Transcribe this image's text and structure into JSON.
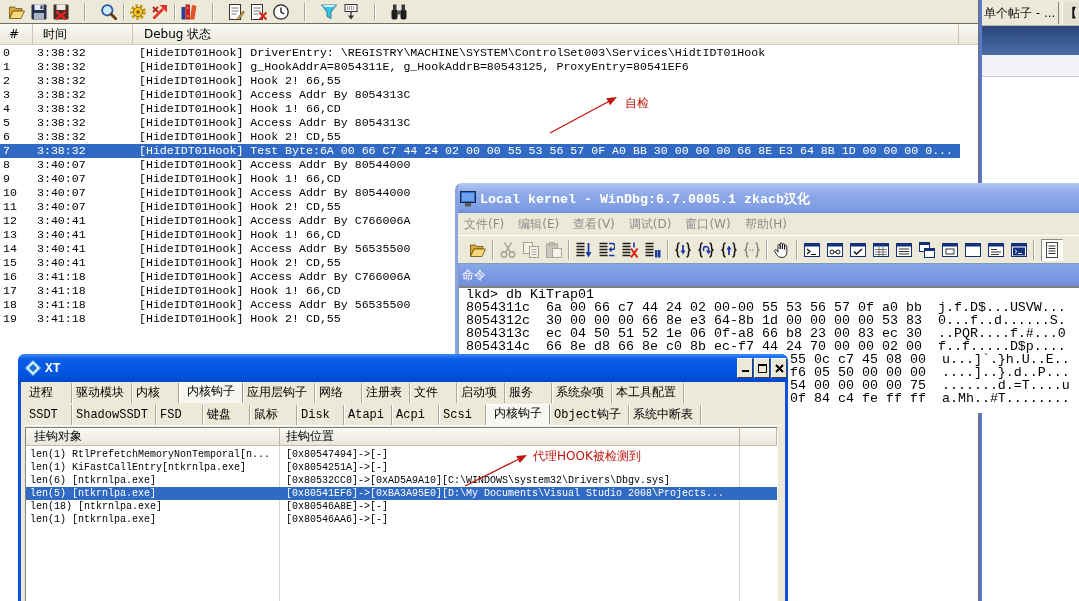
{
  "log_viewer": {
    "columns": [
      "#",
      "时间",
      "Debug 状态"
    ],
    "rows": [
      {
        "index": "0",
        "time": "3:38:32",
        "message": "[HideIDT01Hook] DriverEntry: \\REGISTRY\\MACHINE\\SYSTEM\\ControlSet003\\Services\\HidtIDT01Hook",
        "selected": false
      },
      {
        "index": "1",
        "time": "3:38:32",
        "message": "[HideIDT01Hook] g_HookAddrA=8054311E, g_HookAddrB=80543125, ProxyEntry=80541EF6",
        "selected": false
      },
      {
        "index": "2",
        "time": "3:38:32",
        "message": "[HideIDT01Hook] Hook 2! 66,55",
        "selected": false
      },
      {
        "index": "3",
        "time": "3:38:32",
        "message": "[HideIDT01Hook] Access Addr By 8054313C",
        "selected": false
      },
      {
        "index": "4",
        "time": "3:38:32",
        "message": "[HideIDT01Hook] Hook 1! 66,CD",
        "selected": false
      },
      {
        "index": "5",
        "time": "3:38:32",
        "message": "[HideIDT01Hook] Access Addr By 8054313C",
        "selected": false
      },
      {
        "index": "6",
        "time": "3:38:32",
        "message": "[HideIDT01Hook] Hook 2! CD,55",
        "selected": false
      },
      {
        "index": "7",
        "time": "3:38:32",
        "message": "[HideIDT01Hook] Test Byte:6A 00 66 C7 44 24 02 00 00 55 53 56 57 0F A0 BB 30 00 00 00 66 8E E3 64 8B 1D 00 00 00 0...",
        "selected": true
      },
      {
        "index": "8",
        "time": "3:40:07",
        "message": "[HideIDT01Hook] Access Addr By 80544000",
        "selected": false
      },
      {
        "index": "9",
        "time": "3:40:07",
        "message": "[HideIDT01Hook] Hook 1! 66,CD",
        "selected": false
      },
      {
        "index": "10",
        "time": "3:40:07",
        "message": "[HideIDT01Hook] Access Addr By 80544000",
        "selected": false
      },
      {
        "index": "11",
        "time": "3:40:07",
        "message": "[HideIDT01Hook] Hook 2! CD,55",
        "selected": false
      },
      {
        "index": "12",
        "time": "3:40:41",
        "message": "[HideIDT01Hook] Access Addr By C766006A",
        "selected": false
      },
      {
        "index": "13",
        "time": "3:40:41",
        "message": "[HideIDT01Hook] Hook 1! 66,CD",
        "selected": false
      },
      {
        "index": "14",
        "time": "3:40:41",
        "message": "[HideIDT01Hook] Access Addr By 56535500",
        "selected": false
      },
      {
        "index": "15",
        "time": "3:40:41",
        "message": "[HideIDT01Hook] Hook 2! CD,55",
        "selected": false
      },
      {
        "index": "16",
        "time": "3:41:18",
        "message": "[HideIDT01Hook] Access Addr By C766006A",
        "selected": false
      },
      {
        "index": "17",
        "time": "3:41:18",
        "message": "[HideIDT01Hook] Hook 1! 66,CD",
        "selected": false
      },
      {
        "index": "18",
        "time": "3:41:18",
        "message": "[HideIDT01Hook] Access Addr By 56535500",
        "selected": false
      },
      {
        "index": "19",
        "time": "3:41:18",
        "message": "[HideIDT01Hook] Hook 2! CD,55",
        "selected": false
      }
    ]
  },
  "background_window": {
    "taskbar_buttons": [
      "单个帖子 - ...",
      "【"
    ]
  },
  "debugger": {
    "title": "Local kernel - WinDbg:6.7.0005.1 zkacb汉化",
    "menu": [
      {
        "label": "文件(F)",
        "disabled": true
      },
      {
        "label": "编辑(E)",
        "disabled": true
      },
      {
        "label": "查看(V)",
        "disabled": true
      },
      {
        "label": "调试(D)",
        "disabled": true
      },
      {
        "label": "窗口(W)",
        "disabled": true
      },
      {
        "label": "帮助(H)",
        "disabled": true
      }
    ],
    "toolbar": [
      {
        "disabled": false,
        "pressed": false
      },
      {
        "disabled": true,
        "pressed": false
      },
      {
        "disabled": true,
        "pressed": false
      },
      {
        "disabled": true,
        "pressed": false
      },
      {
        "disabled": false,
        "pressed": false
      },
      {
        "disabled": false,
        "pressed": false
      },
      {
        "disabled": false,
        "pressed": false
      },
      {
        "disabled": false,
        "pressed": false
      },
      {
        "disabled": false,
        "pressed": false
      },
      {
        "disabled": false,
        "pressed": false
      },
      {
        "disabled": false,
        "pressed": false
      },
      {
        "disabled": true,
        "pressed": false
      },
      {
        "disabled": false,
        "pressed": false
      },
      {
        "disabled": false,
        "pressed": false
      },
      {
        "disabled": false,
        "pressed": false
      },
      {
        "disabled": false,
        "pressed": false
      },
      {
        "disabled": false,
        "pressed": false
      },
      {
        "disabled": false,
        "pressed": false
      },
      {
        "disabled": false,
        "pressed": false
      },
      {
        "disabled": false,
        "pressed": false
      },
      {
        "disabled": false,
        "pressed": false
      },
      {
        "disabled": false,
        "pressed": false
      },
      {
        "disabled": false,
        "pressed": false
      },
      {
        "disabled": false,
        "pressed": true
      }
    ],
    "pane_title": "命令",
    "lines": [
      {
        "kind": "prompt",
        "text": "lkd> db KiTrap01"
      },
      {
        "kind": "dump",
        "text": "8054311c  6a 00 66 c7 44 24 02 00-00 55 53 56 57 0f a0 bb  j.f.D$...USVW..."
      },
      {
        "kind": "dump",
        "text": "8054312c  30 00 00 00 66 8e e3 64-8b 1d 00 00 00 00 53 83  0...f..d......S."
      },
      {
        "kind": "dump",
        "text": "8054313c  ec 04 50 51 52 1e 06 0f-a8 66 b8 23 00 83 ec 30  ..PQR....f.#...0"
      },
      {
        "kind": "dump",
        "text": "8054314c  66 8e d8 66 8e c0 8b ec-f7 44 24 70 00 00 02 00  f..f.....D$p...."
      },
      {
        "kind": "tail",
        "text": "55 0c c7 45 08 00  u...]`.}h.U..E.."
      },
      {
        "kind": "tail",
        "text": "f6 05 50 00 00 00  ....]..}.d..P..."
      },
      {
        "kind": "tail",
        "text": "54 00 00 00 00 75  .......d.=T....u"
      },
      {
        "kind": "tail",
        "text": "0f 84 c4 fe ff ff  a.Mh..#T........"
      }
    ]
  },
  "tool_window": {
    "title": "XT",
    "tabs": [
      {
        "label": "进程",
        "selected": false
      },
      {
        "label": "驱动模块",
        "selected": false
      },
      {
        "label": "内核",
        "selected": false
      },
      {
        "label": "内核钩子",
        "selected": true
      },
      {
        "label": "应用层钩子",
        "selected": false
      },
      {
        "label": "网络",
        "selected": false
      },
      {
        "label": "注册表",
        "selected": false
      },
      {
        "label": "文件",
        "selected": false
      },
      {
        "label": "启动项",
        "selected": false
      },
      {
        "label": "服务",
        "selected": false
      },
      {
        "label": "系统杂项",
        "selected": false
      },
      {
        "label": "本工具配置",
        "selected": false
      }
    ],
    "subtabs": [
      {
        "label": "SSDT",
        "selected": false
      },
      {
        "label": "ShadowSSDT",
        "selected": false
      },
      {
        "label": "FSD",
        "selected": false
      },
      {
        "label": "键盘",
        "selected": false
      },
      {
        "label": "鼠标",
        "selected": false
      },
      {
        "label": "Disk",
        "selected": false
      },
      {
        "label": "Atapi",
        "selected": false
      },
      {
        "label": "Acpi",
        "selected": false
      },
      {
        "label": "Scsi",
        "selected": false
      },
      {
        "label": "内核钩子",
        "selected": true
      },
      {
        "label": "Object钩子",
        "selected": false
      },
      {
        "label": "系统中断表",
        "selected": false
      }
    ],
    "hook_list": {
      "columns": [
        "挂钩对象",
        "挂钩位置"
      ],
      "rows": [
        {
          "object": "len(1) RtlPrefetchMemoryNonTemporal[n...",
          "location": "[0x80547494]->[-]",
          "selected": false
        },
        {
          "object": "len(1) KiFastCallEntry[ntkrnlpa.exe]",
          "location": "[0x8054251A]->[-]",
          "selected": false
        },
        {
          "object": "len(6) [ntkrnlpa.exe]",
          "location": "[0x80532CC0]->[0xAD5A9A10][C:\\WINDOWS\\system32\\Drivers\\Dbgv.sys]",
          "selected": false
        },
        {
          "object": "len(5) [ntkrnlpa.exe]",
          "location": "[0x80541EF6]->[0xBA3A95E0][D:\\My Documents\\Visual Studio 2008\\Projects...",
          "selected": true
        },
        {
          "object": "len(18) [ntkrnlpa.exe]",
          "location": "[0x80546A8E]->[-]",
          "selected": false
        },
        {
          "object": "len(1) [ntkrnlpa.exe]",
          "location": "[0x80546AA6]->[-]",
          "selected": false
        }
      ]
    }
  },
  "annotations": [
    {
      "text": "自检"
    },
    {
      "text": "代理HOOK被检测到"
    }
  ]
}
